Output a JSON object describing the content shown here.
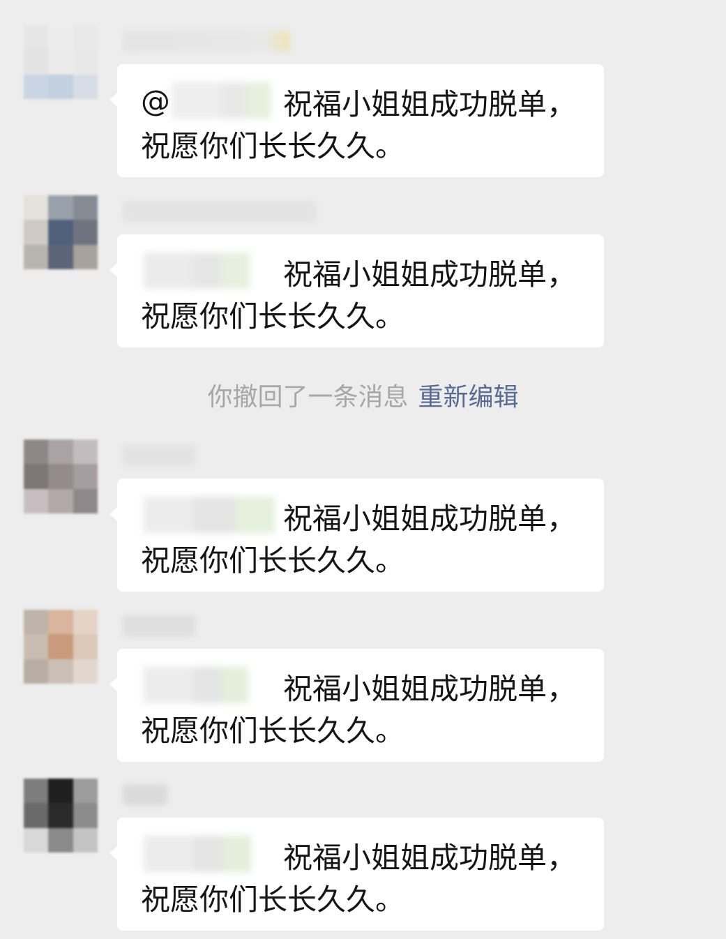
{
  "messages": [
    {
      "mention_prefix": "@",
      "text_line1": "祝福小姐姐成功脱单，",
      "text_line2": "祝愿你们长长久久。"
    },
    {
      "mention_prefix": "",
      "text_line1": "祝福小姐姐成功脱单，",
      "text_line2": "祝愿你们长长久久。"
    },
    {
      "mention_prefix": "",
      "text_line1": "祝福小姐姐成功脱单，",
      "text_line2": "祝愿你们长长久久。"
    },
    {
      "mention_prefix": "",
      "text_line1": "祝福小姐姐成功脱单，",
      "text_line2": "祝愿你们长长久久。"
    },
    {
      "mention_prefix": "",
      "text_line1": "祝福小姐姐成功脱单，",
      "text_line2": "祝愿你们长长久久。"
    }
  ],
  "system_notice": {
    "text": "你撤回了一条消息",
    "action_label": "重新编辑"
  },
  "colors": {
    "background": "#ededed",
    "bubble": "#ffffff",
    "link": "#576b95",
    "system_text": "#a7a7a7"
  }
}
